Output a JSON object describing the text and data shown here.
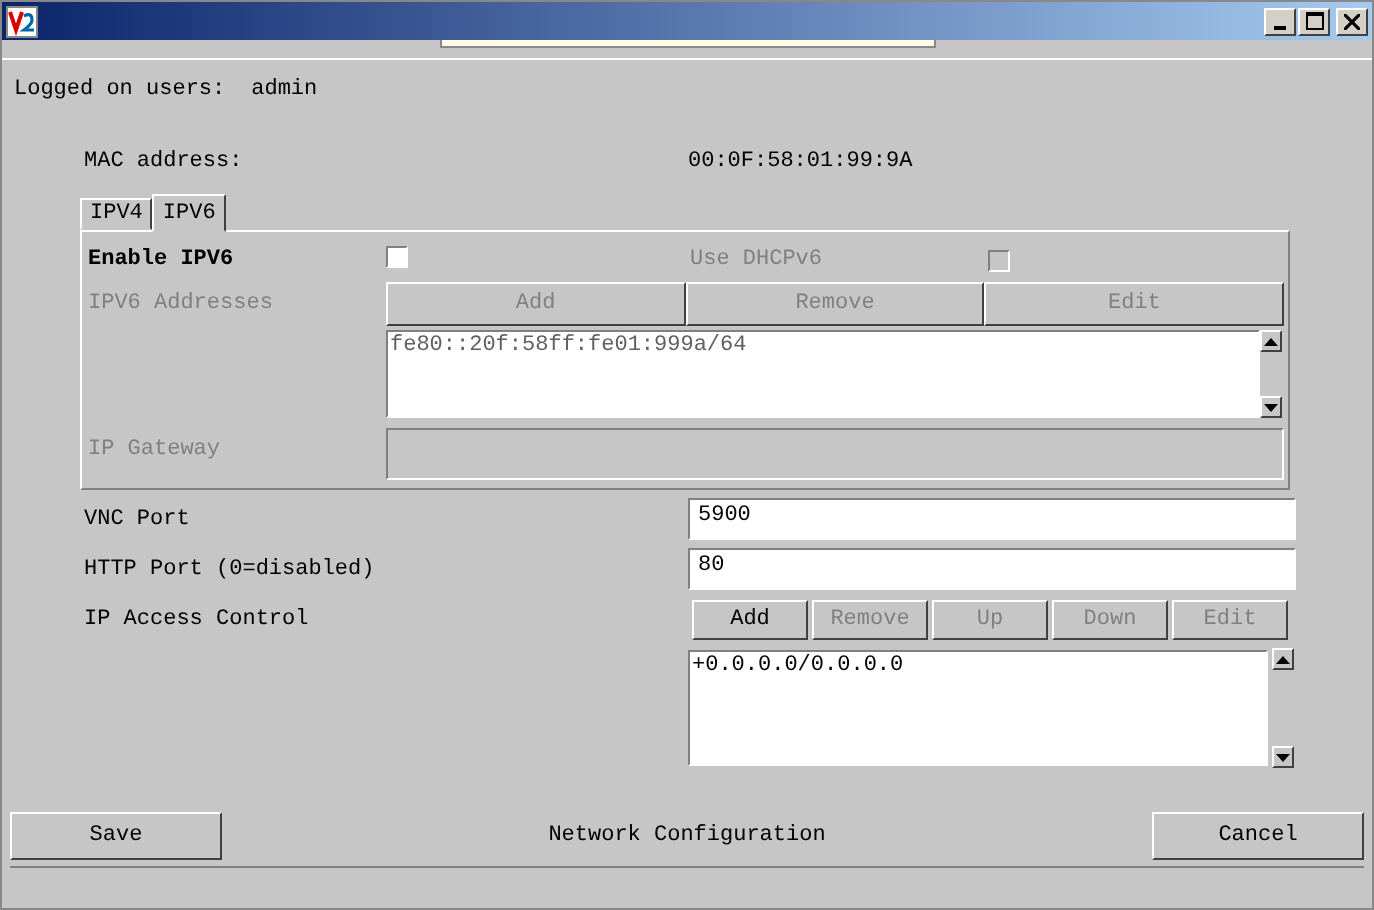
{
  "logged_on": {
    "label": "Logged on users:",
    "value": "admin"
  },
  "mac": {
    "label": "MAC address:",
    "value": "00:0F:58:01:99:9A"
  },
  "tabs": [
    {
      "label": "IPV4",
      "selected": false
    },
    {
      "label": "IPV6",
      "selected": true
    }
  ],
  "ipv6": {
    "enable": {
      "label": "Enable IPV6",
      "checked": false,
      "disabled": false
    },
    "dhcp": {
      "label": "Use DHCPv6",
      "checked": false,
      "disabled": true
    },
    "addresses": {
      "label": "IPV6 Addresses",
      "disabled": true,
      "buttons": [
        {
          "label": "Add",
          "disabled": true
        },
        {
          "label": "Remove",
          "disabled": true
        },
        {
          "label": "Edit",
          "disabled": true
        }
      ],
      "items": [
        "fe80::20f:58ff:fe01:999a/64"
      ]
    },
    "gateway": {
      "label": "IP Gateway",
      "disabled": true
    }
  },
  "vnc_port": {
    "label": "VNC Port",
    "value": "5900"
  },
  "http_port": {
    "label": "HTTP Port (0=disabled)",
    "value": "80"
  },
  "access": {
    "label": "IP Access Control",
    "buttons": [
      {
        "label": "Add",
        "disabled": false
      },
      {
        "label": "Remove",
        "disabled": true
      },
      {
        "label": "Up",
        "disabled": true
      },
      {
        "label": "Down",
        "disabled": true
      },
      {
        "label": "Edit",
        "disabled": true
      }
    ],
    "items": [
      "+0.0.0.0/0.0.0.0"
    ]
  },
  "footer": {
    "save": "Save",
    "title": "Network Configuration",
    "cancel": "Cancel"
  }
}
